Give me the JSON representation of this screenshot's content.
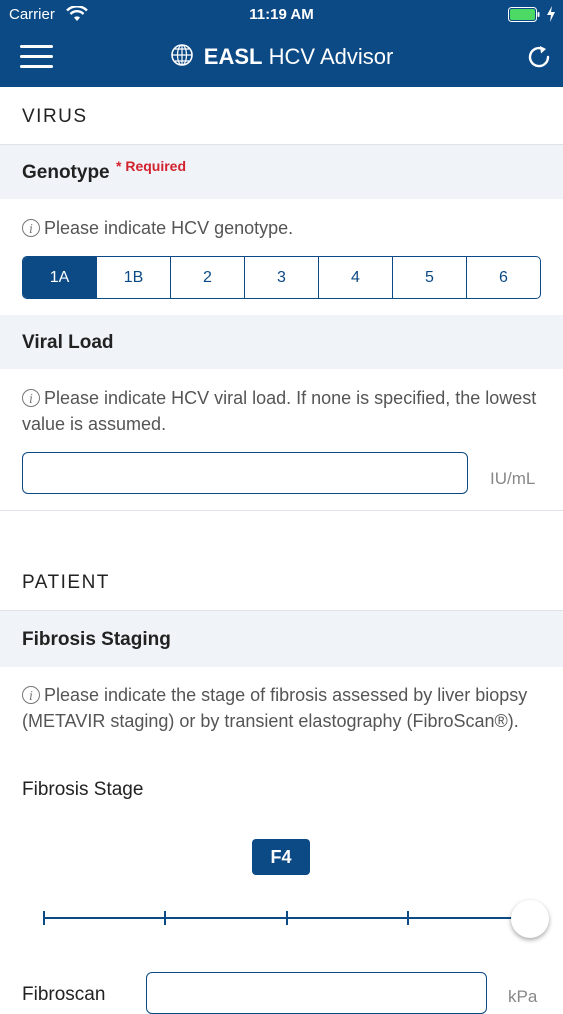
{
  "status_bar": {
    "carrier": "Carrier",
    "time": "11:19 AM"
  },
  "nav": {
    "brand_strong": "EASL",
    "brand_rest": "HCV Advisor"
  },
  "virus": {
    "section_title": "VIRUS",
    "genotype": {
      "title": "Genotype",
      "required": "* Required",
      "hint": "Please indicate HCV genotype.",
      "options": [
        "1A",
        "1B",
        "2",
        "3",
        "4",
        "5",
        "6"
      ],
      "selected": "1A"
    },
    "viral_load": {
      "title": "Viral Load",
      "hint": "Please indicate HCV viral load. If none is specified, the lowest value is assumed.",
      "value": "",
      "unit": "IU/mL"
    }
  },
  "patient": {
    "section_title": "PATIENT",
    "fibrosis": {
      "title": "Fibrosis Staging",
      "hint": "Please indicate the stage of fibrosis assessed by liver biopsy (METAVIR staging) or by transient elastography (FibroScan®).",
      "stage_label": "Fibrosis Stage",
      "stage_value": "F4",
      "fibroscan_label": "Fibroscan",
      "fibroscan_value": "",
      "fibroscan_unit": "kPa"
    }
  },
  "icons": [
    "wifi-icon",
    "battery-icon",
    "menu-icon",
    "logo-icon",
    "refresh-icon",
    "info-icon"
  ],
  "colors": {
    "primary": "#0c4a85",
    "required": "#d2222d",
    "field_header_bg": "#f0f4f8"
  }
}
